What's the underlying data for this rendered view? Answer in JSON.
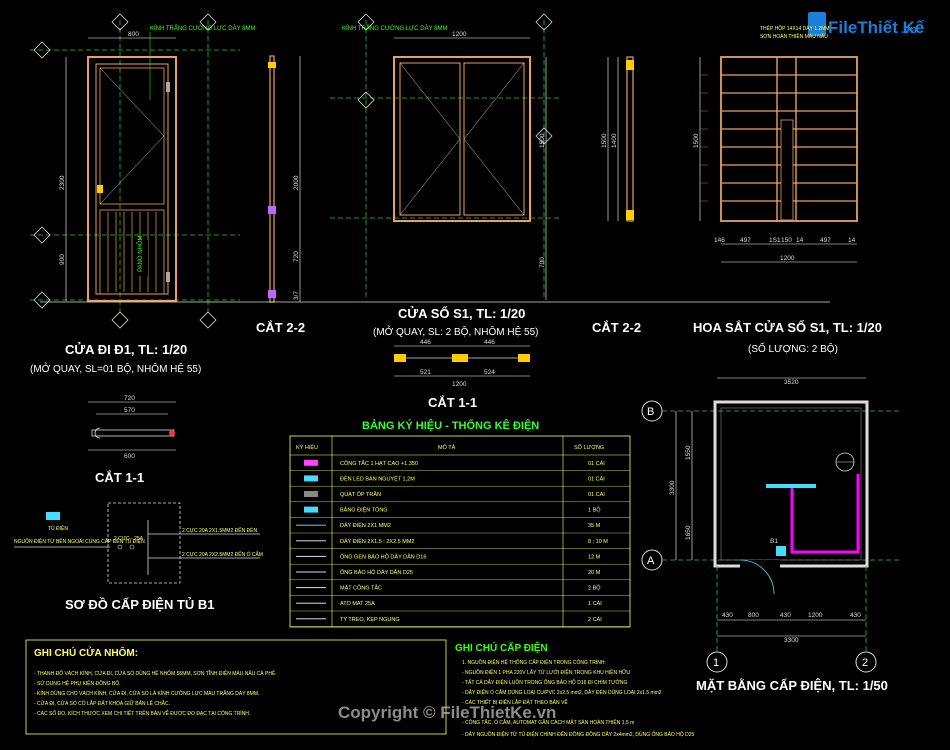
{
  "logo": {
    "text": "FileThiết Kế",
    "suffix": ".vn",
    "brand_color": "#1a7fd8"
  },
  "watermark": "Copyright © FileThietKe.vn",
  "door": {
    "title": "CỬA ĐI Đ1, TL: 1/20",
    "subtitle": "(MỞ QUAY, SL=01 BỘ, NHÔM HỆ 55)",
    "note": "KÍNH TRẮNG CƯỜNG LỰC DÀY 8MM",
    "dim_width": "800",
    "dim_height": "2300",
    "dim_lower": "900",
    "panel_label": "PANO NHÔM"
  },
  "section_door": {
    "title": "CẮT 2-2",
    "dim_a": "2000",
    "dim_b": "720",
    "dim_c": "3/7"
  },
  "window": {
    "title": "CỬA SỔ S1, TL: 1/20",
    "subtitle": "(MỞ QUAY, SL: 2 BỘ, NHÔM HỆ 55)",
    "note": "KÍNH TRẮNG CƯỜNG LỰC DÀY 8MM",
    "dim_width": "1200",
    "dim_height": "1500",
    "dim_inner": "1400",
    "dim_sill": "700"
  },
  "section_window": {
    "title": "CẮT 2-2",
    "dim_a": "1500",
    "dim_b": "1400"
  },
  "grille": {
    "title": "HOA SẮT CỬA SỔ S1, TL: 1/20",
    "subtitle": "(SỐ LƯỢNG: 2 BỘ)",
    "note_a": "THÉP HỘP 14X14 DÀY 1.2MM",
    "note_b": "SƠN HOÀN THIỆN MÀU NÂU",
    "dim_side": "1500",
    "dims_bottom": [
      "146",
      "497",
      "1S1",
      "150",
      "14",
      "497",
      "14"
    ],
    "dim_total": "1200"
  },
  "section_window_11": {
    "title": "CẮT 1-1",
    "dims_top": [
      "446",
      "446"
    ],
    "dims_bottom": [
      "521",
      "524"
    ],
    "dim_total": "1200"
  },
  "section_door_11": {
    "title": "CẮT 1-1",
    "dim_a": "720",
    "dim_b": "570",
    "dim_c": "600"
  },
  "legend": {
    "title": "BẢNG KÝ HIỆU - THỐNG KÊ ĐIỆN",
    "headers": [
      "KÝ HIỆU",
      "MÔ TẢ",
      "SỐ LƯỢNG"
    ],
    "rows": [
      {
        "desc": "CÔNG TẮC 1 HẠT CAO +1.350",
        "qty": "01 CÁI"
      },
      {
        "desc": "ĐÈN LED BÁN NGUYỆT 1,2M",
        "qty": "01 CÁI"
      },
      {
        "desc": "QUẠT ỐP TRẦN",
        "qty": "01 CÁI"
      },
      {
        "desc": "BẢNG ĐIỆN TỔNG",
        "qty": "1 BỘ"
      },
      {
        "desc": "DÂY ĐIỆN 2X1 MM2",
        "qty": "35 M"
      },
      {
        "desc": "DÂY ĐIỆN 2X1.5 : 2X2.5 MM2",
        "qty": "8 ; 10 M"
      },
      {
        "desc": "ỐNG GEN BẢO HỘ DÂY DẪN D16",
        "qty": "12 M"
      },
      {
        "desc": "ỐNG BẢO HỘ DÂY DẪN D25",
        "qty": "20 M"
      },
      {
        "desc": "MẶT CÔNG TẮC",
        "qty": "2 BỘ"
      },
      {
        "desc": "ATO MAT 25A",
        "qty": "1 CÁI"
      },
      {
        "desc": "TY TREO, KẸP NGUNG",
        "qty": "2 CÁI"
      }
    ]
  },
  "schematic": {
    "title": "SƠ ĐỒ CẤP ĐIỆN TỦ B1",
    "box_label": "TỦ ĐIỆN",
    "breaker": "2 CỰC - 25A",
    "input": "NGUỒN ĐIỆN TỪ BÊN NGOÀI CUNG CẤP ĐẾN TỦ ĐIỆN",
    "out_a": "2 CỰC 20A 2X1.5MM2 ĐẾN ĐÈN",
    "out_b": "2 CỰC 20A 2X2.5MM2 ĐẾN Ổ CẮM"
  },
  "plan": {
    "title": "MẶT BẰNG CẤP ĐIỆN, TL: 1/50",
    "grid_a": "A",
    "grid_b": "B",
    "grid_1": "1",
    "grid_2": "2",
    "dim_top": "3520",
    "dim_left_total": "3300",
    "dim_left_a": "1550",
    "dim_left_b": "1650",
    "dims_bottom": [
      "430",
      "800",
      "430",
      "1200",
      "430"
    ],
    "dim_bottom_total": "3300",
    "panel_tag": "B1",
    "wire_color": "#ff00ff"
  },
  "notes_alu": {
    "title": "GHI CHÚ CỬA NHÔM:",
    "lines": [
      "- THANH ĐỐ VÁCH KÍNH, CỬA ĐI, CỬA SỔ DÙNG HỆ NHÔM 55MM, SƠN TĨNH ĐIỆN MÀU NÂU CÀ PHÊ.",
      "- SỬ DỤNG HỆ PHỤ KIỆN ĐỒNG BỘ.",
      "- KÍNH DÙNG CHO VÁCH KÍNH, CỬA ĐI, CỬA SỔ LÀ KÍNH CƯỜNG LỰC MÀU TRẮNG DÀY 8MM.",
      "- CỬA ĐI, CỬA SỔ CÓ LẮP ĐẶT KHÓA GIỮ BẢN LỀ CHẮC.",
      "- CÁC SỐ ĐO, KÍCH THƯỚC XEM CHI TIẾT TRÊN BẢN VẼ ĐƯỢC ĐO ĐẠC TẠI CÔNG TRÌNH."
    ]
  },
  "notes_elec": {
    "title": "GHI CHÚ CẤP ĐIỆN",
    "lines": [
      "1. NGUỒN ĐIỆN HỆ THỐNG CẤP ĐIỆN TRONG CÔNG TRÌNH:",
      "- NGUỒN ĐIỆN 1 PHA 220V LẤY TỪ LƯỚI ĐIỆN TRONG KHU HIỆN HỮU",
      "- TẤT CẢ DÂY ĐIỆN LUỒN TRONG ỐNG BẢO HỘ D16 ĐI CHÌM TƯỜNG",
      "- DÂY ĐIỆN Ổ CẮM DÙNG LOẠI CU/PVC 2x2.5 mm2, DÂY ĐÈN DÙNG LOẠI 2x1.5 mm2",
      "- CÁC THIẾT BỊ ĐIỆN LẮP ĐẶT THEO BẢN VẼ",
      "- CÔNG TẮC, Ổ CẮM, AUTOMAT GẮN CÁCH MẶT SÀN HOÀN THIỆN 1,5 m",
      "- DÂY NGUỒN ĐIỆN TỪ TỦ ĐIỆN CHÍNH ĐẾN ĐỒNG ĐỒNG DÂY 2x4mm2, DÙNG ỐNG BẢO HỘ D25"
    ]
  }
}
